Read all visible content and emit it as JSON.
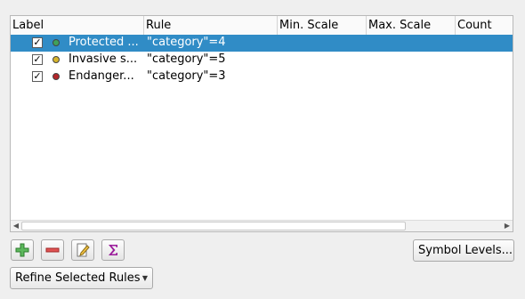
{
  "columns": [
    "Label",
    "Rule",
    "Min. Scale",
    "Max. Scale",
    "Count"
  ],
  "rows": [
    {
      "label": "Protected ...",
      "rule": "\"category\"=4",
      "checked": true,
      "color": "#3fa15a",
      "selected": true
    },
    {
      "label": "Invasive s...",
      "rule": "\"category\"=5",
      "checked": true,
      "color": "#d6b42c",
      "selected": false
    },
    {
      "label": "Endanger...",
      "rule": "\"category\"=3",
      "checked": true,
      "color": "#b3262a",
      "selected": false
    }
  ],
  "toolbar": {
    "add_icon": "plus-icon",
    "remove_icon": "minus-icon",
    "edit_icon": "pencil-icon",
    "sum_icon": "sigma-icon"
  },
  "buttons": {
    "symbol_levels": "Symbol Levels...",
    "refine_rules": "Refine Selected Rules"
  },
  "colors": {
    "selection": "#308cc6",
    "add_green": "#3a9a3a",
    "remove_red": "#d43a3a",
    "sigma_purple": "#9b1c9b"
  }
}
